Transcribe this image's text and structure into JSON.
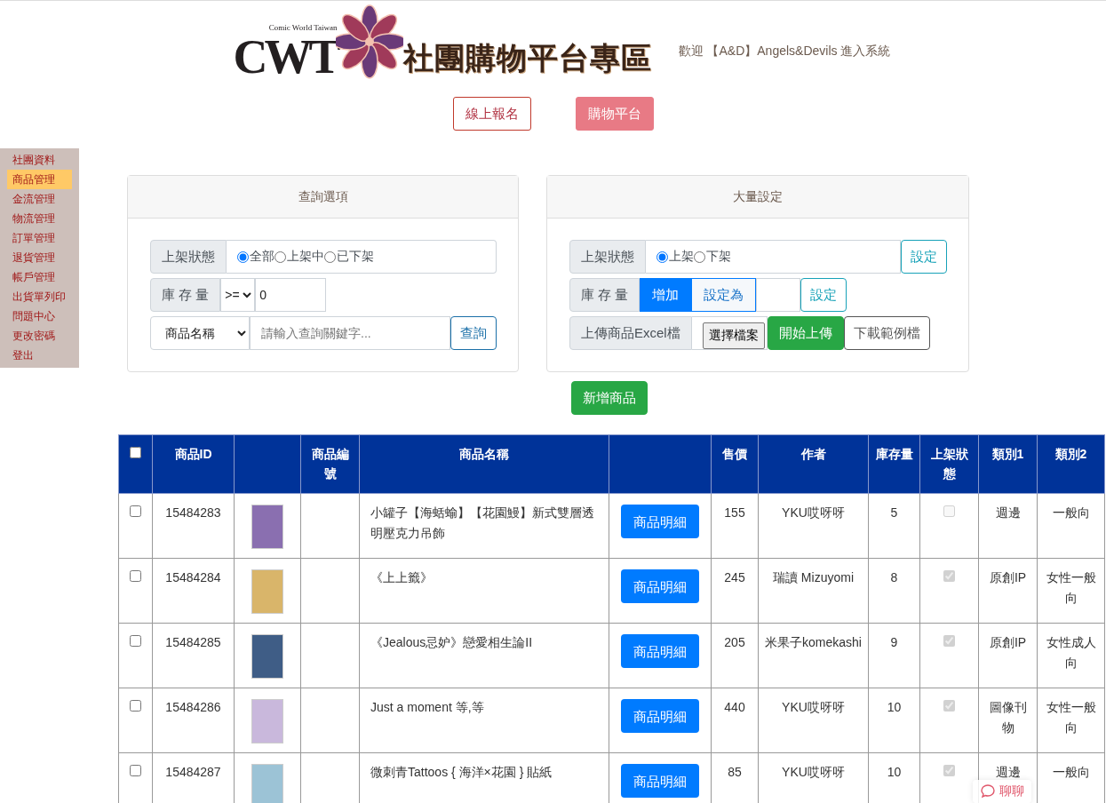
{
  "logo": {
    "mark": "CWT",
    "subtitle": "Comic World Taiwan",
    "title": "社團購物平台專區"
  },
  "welcome": "歡迎 【A&D】Angels&Devils 進入系統",
  "nav": [
    {
      "label": "線上報名",
      "selected": false
    },
    {
      "label": "購物平台",
      "selected": true
    }
  ],
  "sidebar": {
    "items": [
      {
        "label": "社團資料",
        "selected": false
      },
      {
        "label": "商品管理",
        "selected": true
      },
      {
        "label": "金流管理",
        "selected": false
      },
      {
        "label": "物流管理",
        "selected": false
      },
      {
        "label": "訂單管理",
        "selected": false
      },
      {
        "label": "退貨管理",
        "selected": false
      },
      {
        "label": "帳戶管理",
        "selected": false
      },
      {
        "label": "出貨單列印",
        "selected": false
      },
      {
        "label": "問題中心",
        "selected": false
      },
      {
        "label": "更改密碼",
        "selected": false
      },
      {
        "label": "登出",
        "selected": false
      }
    ]
  },
  "query_panel": {
    "title": "查詢選項",
    "status_label": "上架狀態",
    "status_options": [
      {
        "label": "全部",
        "selected": true
      },
      {
        "label": "上架中",
        "selected": false
      },
      {
        "label": "已下架",
        "selected": false
      }
    ],
    "stock_label": "庫 存 量",
    "stock_operator": ">=",
    "stock_value": "0",
    "field_select": "商品名稱",
    "keyword_placeholder": "請輸入查詢關鍵字...",
    "search_button": "查詢"
  },
  "bulk_panel": {
    "title": "大量設定",
    "status_label": "上架狀態",
    "status_options": [
      {
        "label": "上架",
        "selected": true
      },
      {
        "label": "下架",
        "selected": false
      }
    ],
    "status_button": "設定",
    "stock_label": "庫 存 量",
    "stock_modes": [
      {
        "label": "增加",
        "selected": true
      },
      {
        "label": "設定為",
        "selected": false
      }
    ],
    "stock_button": "設定",
    "upload_label": "上傳商品Excel檔",
    "file_button": "選擇檔案",
    "upload_button": "開始上傳",
    "download_button": "下載範例檔"
  },
  "add_button": "新增商品",
  "table": {
    "select_all": false,
    "columns": [
      "商品ID",
      "商品編號",
      "商品名稱",
      "售價",
      "作者",
      "庫存量",
      "上架狀態",
      "類別1",
      "類別2"
    ],
    "rows": [
      {
        "checked": false,
        "id": "15484283",
        "name": "小罐子【海蛞蝓】【花園鰻】新式雙層透明壓克力吊飾",
        "button": "商品明細",
        "price": "155",
        "author": "YKU哎呀呀",
        "stock": "5",
        "listed": false,
        "cat1": "週邊",
        "cat2": "一般向"
      },
      {
        "checked": false,
        "id": "15484284",
        "name": "《上上籤》",
        "button": "商品明細",
        "price": "245",
        "author": "瑞讀 Mizuyomi",
        "stock": "8",
        "listed": true,
        "cat1": "原創IP",
        "cat2": "女性一般向"
      },
      {
        "checked": false,
        "id": "15484285",
        "name": "《Jealous忌妒》戀愛相生論II",
        "button": "商品明細",
        "price": "205",
        "author": "米果子komekashi",
        "stock": "9",
        "listed": true,
        "cat1": "原創IP",
        "cat2": "女性成人向"
      },
      {
        "checked": false,
        "id": "15484286",
        "name": "Just a moment 等,等",
        "button": "商品明細",
        "price": "440",
        "author": "YKU哎呀呀",
        "stock": "10",
        "listed": true,
        "cat1": "圖像刊物",
        "cat2": "女性一般向"
      },
      {
        "checked": false,
        "id": "15484287",
        "name": "微刺青Tattoos { 海洋×花園 } 貼紙",
        "button": "商品明細",
        "price": "85",
        "author": "YKU哎呀呀",
        "stock": "10",
        "listed": true,
        "cat1": "週邊",
        "cat2": "一般向"
      }
    ]
  },
  "chat_widget": "聊聊"
}
